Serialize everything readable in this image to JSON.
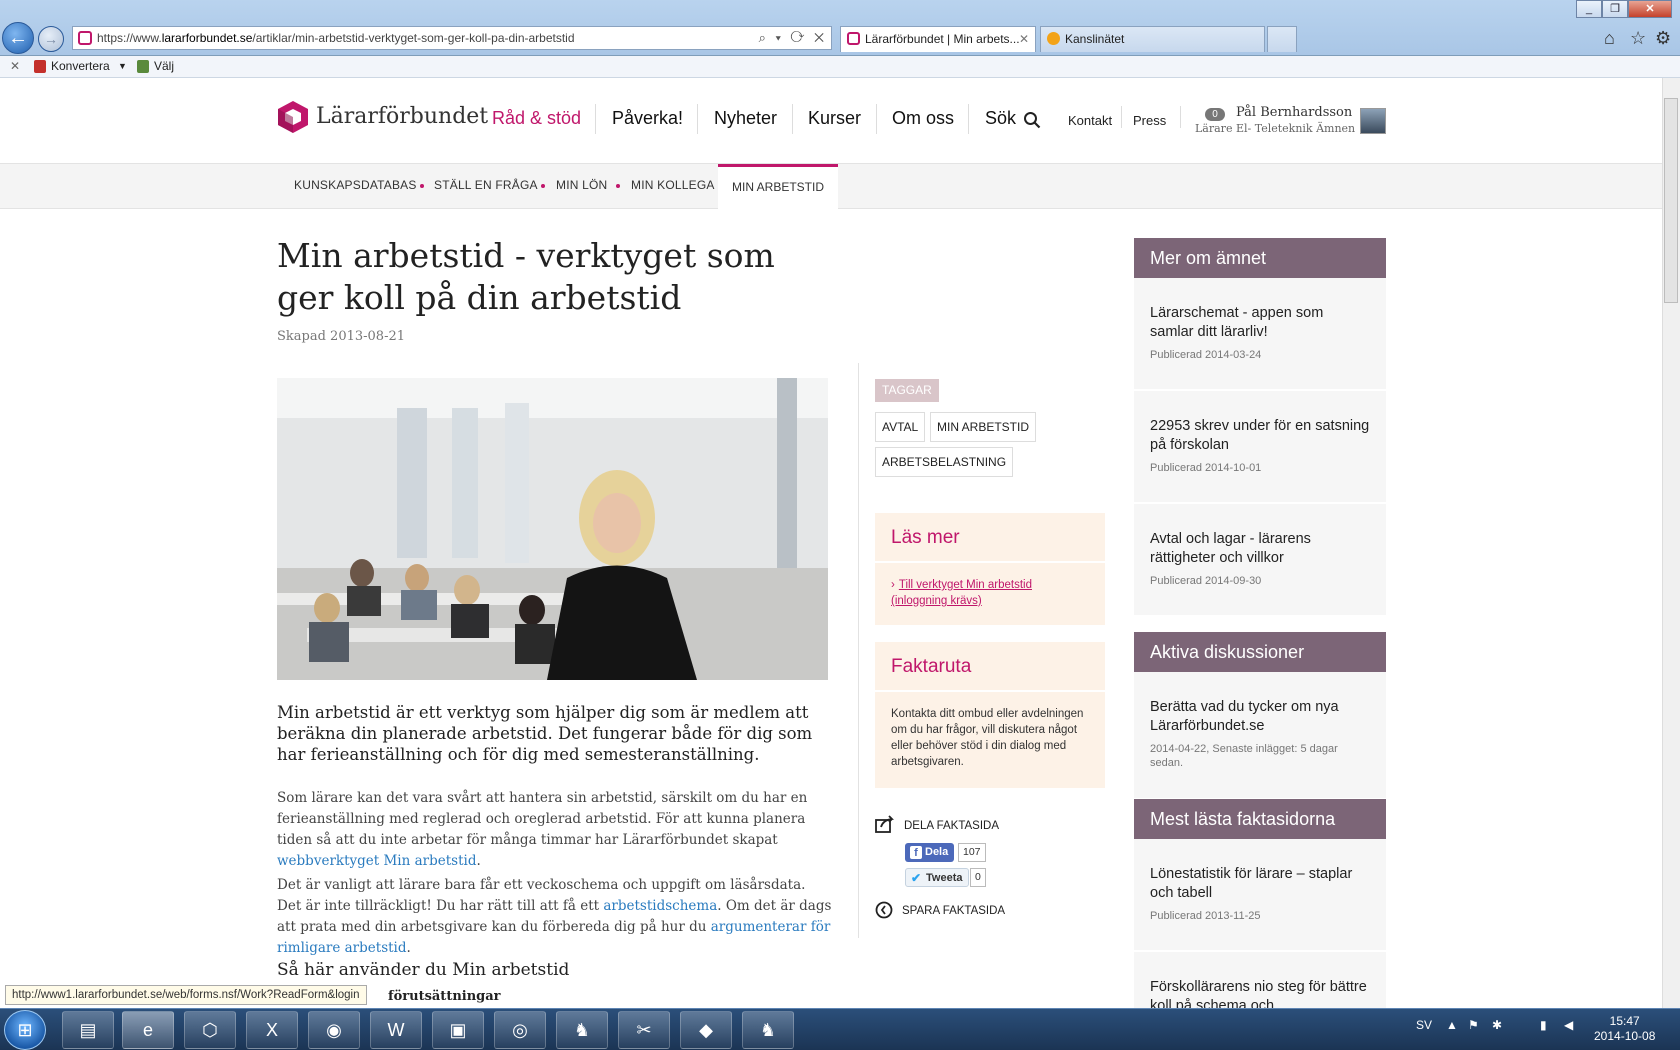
{
  "browser": {
    "url_prefix": "https://www.",
    "url_domain": "lararforbundet.se",
    "url_path": "/artiklar/min-arbetstid-verktyget-som-ger-koll-pa-din-arbetstid",
    "tabs": [
      {
        "label": "Lärarförbundet | Min arbets...",
        "active": true
      },
      {
        "label": "Kanslinätet",
        "active": false
      }
    ],
    "cmd_convert": "Konvertera",
    "cmd_select": "Välj"
  },
  "header": {
    "logo_text": "Lärarförbundet",
    "nav": [
      "Råd & stöd",
      "Påverka!",
      "Nyheter",
      "Kurser",
      "Om oss",
      "Sök"
    ],
    "top_links": [
      "Kontakt",
      "Press"
    ],
    "user_badge": "0",
    "user_name": "Pål Bernhardsson",
    "user_role": "Lärare El- Teleteknik Ämnen"
  },
  "subnav": {
    "items": [
      "KUNSKAPSDATABAS",
      "STÄLL EN FRÅGA",
      "MIN LÖN",
      "MIN KOLLEGA"
    ],
    "active": "MIN ARBETSTID"
  },
  "article": {
    "title": "Min arbetstid - verktyget som ger koll på din arbetstid",
    "created": "Skapad 2013-08-21",
    "lead": "Min arbetstid är ett verktyg som hjälper dig som är medlem att beräkna din planerade arbetstid. Det fungerar både för dig som har ferieanställning och för dig med semesteranställning.",
    "p1_text": "Som lärare kan det vara svårt att hantera sin arbetstid, särskilt om du har en ferieanställning med reglerad och oreglerad arbetstid.  För att kunna planera tiden så att du inte arbetar för många timmar har Lärarförbundet skapat ",
    "p1_link": "webbverktyget Min arbetstid",
    "p1_end": ".",
    "p2_a": "Det är vanligt att lärare bara får ett veckoschema och uppgift om läsårsdata. Det är inte tillräckligt! Du har rätt till att få ett ",
    "p2_link1": "arbetstidschema",
    "p2_b": ". Om det är dags att prata med din arbetsgivare kan du förbereda dig på hur du ",
    "p2_link2": "argumenterar för rimligare arbetstid",
    "p2_end": ".",
    "h3": "Så här använder du Min arbetstid",
    "h4": "förutsättningar"
  },
  "tags": {
    "label": "TAGGAR",
    "items": [
      "AVTAL",
      "MIN ARBETSTID",
      "ARBETSBELASTNING"
    ]
  },
  "read_more": {
    "title": "Läs mer",
    "link": "Till verktyget Min arbetstid (inloggning krävs)"
  },
  "factbox": {
    "title": "Faktaruta",
    "text": "Kontakta ditt ombud eller avdelningen om du har frågor, vill diskutera något eller behöver stöd i din dialog med arbetsgivaren."
  },
  "share": {
    "share_label": "DELA FAKTASIDA",
    "fb_label": "Dela",
    "fb_count": "107",
    "tw_label": "Tweeta",
    "tw_count": "0",
    "save_label": "SPARA FAKTASIDA"
  },
  "sidebar": {
    "more_title": "Mer om ämnet",
    "more_items": [
      {
        "title": "Lärarschemat - appen som samlar ditt lärarliv!",
        "date": "Publicerad 2014-03-24"
      },
      {
        "title": "22953 skrev under för en satsning på förskolan",
        "date": "Publicerad 2014-10-01"
      },
      {
        "title": "Avtal och lagar - lärarens rättigheter och villkor",
        "date": "Publicerad 2014-09-30"
      }
    ],
    "disc_title": "Aktiva diskussioner",
    "disc_items": [
      {
        "title": "Berätta vad du tycker om nya Lärarförbundet.se",
        "date": "2014-04-22, Senaste inlägget: 5 dagar sedan."
      }
    ],
    "read_title": "Mest lästa faktasidorna",
    "read_items": [
      {
        "title": "Lönestatistik för lärare – staplar och tabell",
        "date": "Publicerad 2013-11-25"
      },
      {
        "title": "Förskollärarens nio steg för bättre koll på schema och",
        "date": ""
      }
    ]
  },
  "status": {
    "url": "http://www1.lararforbundet.se/web/forms.nsf/Work?ReadForm&login"
  },
  "taskbar": {
    "lang": "SV",
    "time": "15:47",
    "date": "2014-10-08"
  }
}
